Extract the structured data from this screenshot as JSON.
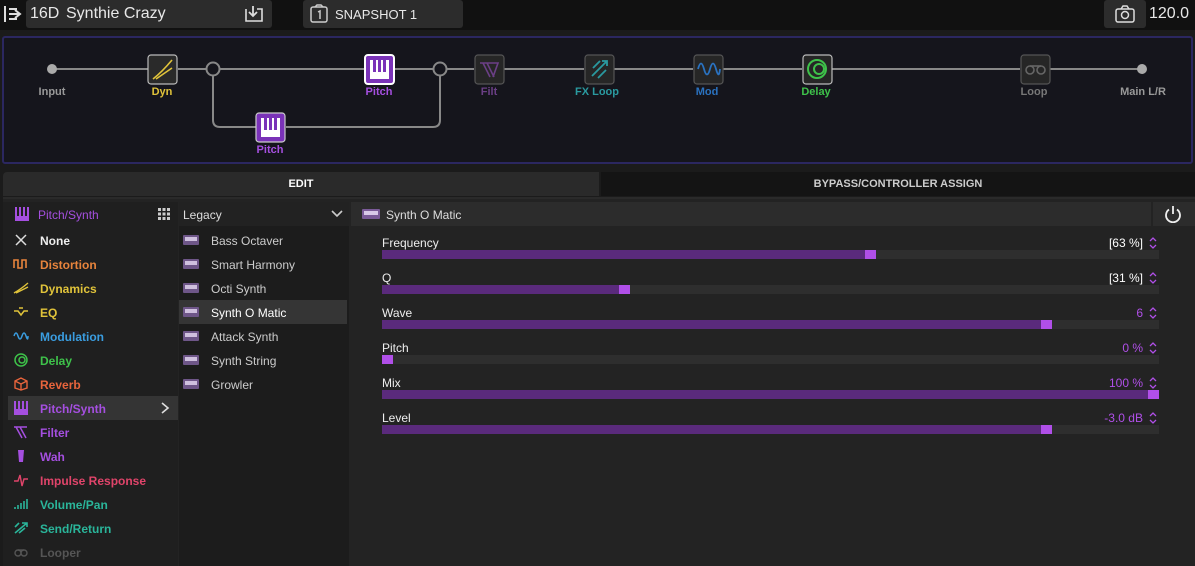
{
  "topbar": {
    "preset_number": "16D",
    "preset_name": "Synthie Crazy",
    "snapshot": "SNAPSHOT 1",
    "tempo": "120.0"
  },
  "signal_chain": {
    "input": "Input",
    "dyn": "Dyn",
    "pitch_a": "Pitch",
    "pitch_b": "Pitch",
    "filt": "Filt",
    "fx_loop": "FX Loop",
    "mod": "Mod",
    "delay": "Delay",
    "loop": "Loop",
    "output": "Main L/R"
  },
  "tabs": {
    "edit": "EDIT",
    "bypass": "BYPASS/CONTROLLER ASSIGN"
  },
  "categories": {
    "header": "Pitch/Synth",
    "items": [
      {
        "label": "None",
        "icon": "x-icon",
        "color": "#dddddd"
      },
      {
        "label": "Distortion",
        "icon": "distortion-icon",
        "color": "#e8843c"
      },
      {
        "label": "Dynamics",
        "icon": "dynamics-icon",
        "color": "#e0c33a"
      },
      {
        "label": "EQ",
        "icon": "eq-icon",
        "color": "#e0c33a"
      },
      {
        "label": "Modulation",
        "icon": "modulation-icon",
        "color": "#3a9de0"
      },
      {
        "label": "Delay",
        "icon": "delay-icon",
        "color": "#3ec24a"
      },
      {
        "label": "Reverb",
        "icon": "reverb-icon",
        "color": "#e8643c"
      },
      {
        "label": "Pitch/Synth",
        "icon": "pitch-synth-icon",
        "color": "#a54fe0"
      },
      {
        "label": "Filter",
        "icon": "filter-icon",
        "color": "#a54fe0"
      },
      {
        "label": "Wah",
        "icon": "wah-icon",
        "color": "#a54fe0"
      },
      {
        "label": "Impulse Response",
        "icon": "impulse-response-icon",
        "color": "#e0446a"
      },
      {
        "label": "Volume/Pan",
        "icon": "volume-pan-icon",
        "color": "#2ab59a"
      },
      {
        "label": "Send/Return",
        "icon": "send-return-icon",
        "color": "#2ab59a"
      },
      {
        "label": "Looper",
        "icon": "looper-icon",
        "color": "#555555"
      }
    ]
  },
  "models": {
    "header": "Legacy",
    "items": [
      "Bass Octaver",
      "Smart Harmony",
      "Octi Synth",
      "Synth O Matic",
      "Attack Synth",
      "Synth String",
      "Growler"
    ]
  },
  "block": {
    "name": "Synth O Matic",
    "params": [
      {
        "name": "Frequency",
        "value": "[63 %]",
        "level": 0.63,
        "value_color": "#ffffff"
      },
      {
        "name": "Q",
        "value": "[31 %]",
        "level": 0.31,
        "value_color": "#ffffff"
      },
      {
        "name": "Wave",
        "value": "6",
        "level": 0.86,
        "value_color": "#b04fe8"
      },
      {
        "name": "Pitch",
        "value": "0 %",
        "level": 0.0,
        "value_color": "#b04fe8"
      },
      {
        "name": "Mix",
        "value": "100 %",
        "level": 1.0,
        "value_color": "#b04fe8"
      },
      {
        "name": "Level",
        "value": "-3.0 dB",
        "level": 0.86,
        "value_color": "#b04fe8"
      }
    ]
  },
  "colors": {
    "accent": "#a54fe0",
    "dyn": "#e0c33a",
    "filt": "#6b3f86",
    "fx_loop": "#2a9aa0",
    "mod": "#2a72c0",
    "delay": "#3ec24a"
  }
}
